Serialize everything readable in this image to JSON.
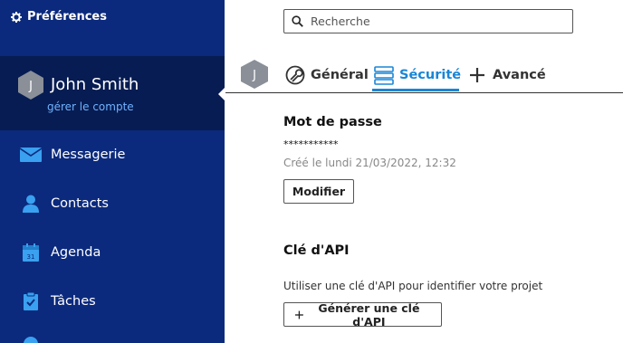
{
  "sidebar": {
    "title": "Préférences",
    "user": {
      "initial": "J",
      "name": "John Smith",
      "manage_label": "gérer le compte"
    },
    "items": [
      {
        "label": "Messagerie",
        "icon": "envelope-icon"
      },
      {
        "label": "Contacts",
        "icon": "person-icon"
      },
      {
        "label": "Agenda",
        "icon": "calendar-icon",
        "badge": "31"
      },
      {
        "label": "Tâches",
        "icon": "clipboard-check-icon"
      }
    ]
  },
  "search": {
    "placeholder": "Recherche"
  },
  "tabs": {
    "avatar_initial": "J",
    "items": [
      {
        "label": "Général",
        "icon": "wrench-icon",
        "active": false
      },
      {
        "label": "Sécurité",
        "icon": "server-icon",
        "active": true
      },
      {
        "label": "Avancé",
        "icon": "plus-icon",
        "active": false
      }
    ]
  },
  "password": {
    "title": "Mot de passe",
    "mask": "***********",
    "created": "Créé le lundi 21/03/2022, 12:32",
    "modify_label": "Modifier"
  },
  "api": {
    "title": "Clé d'API",
    "description": "Utiliser une clé d'API pour identifier votre projet",
    "generate_label": "Générer une clé d'API"
  },
  "colors": {
    "sidebar_bg": "#0b2a7d",
    "user_box_bg": "#071c52",
    "accent": "#1a86d6",
    "link": "#6fb2ff"
  }
}
